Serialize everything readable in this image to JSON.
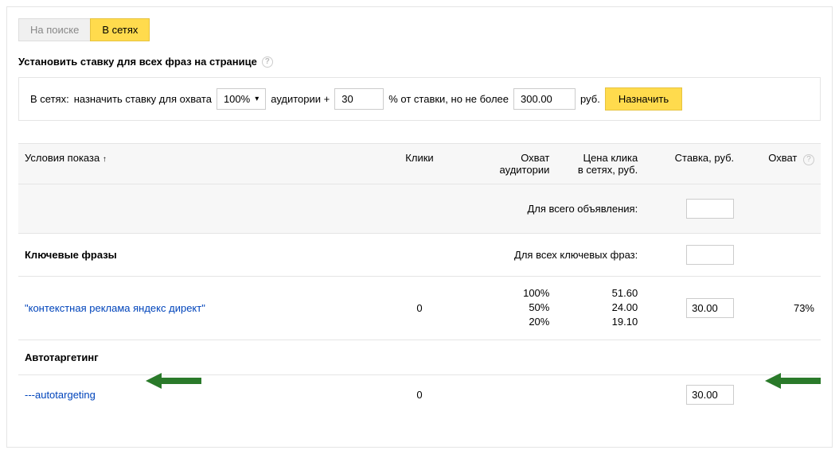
{
  "tabs": {
    "search": "На поиске",
    "networks": "В сетях"
  },
  "heading": "Установить ставку для всех фраз на странице",
  "rule": {
    "prefix": "В сетях:",
    "mid1": "назначить ставку для охвата",
    "pct": "100%",
    "mid2": "аудитории +",
    "plus": "30",
    "mid3": "% от ставки, но не более",
    "cap": "300.00",
    "cur": "руб.",
    "btn": "Назначить"
  },
  "headers": {
    "cond": "Условия показа",
    "sort": "↑",
    "clicks": "Клики",
    "reach_l1": "Охват",
    "reach_l2": "аудитории",
    "cpc_l1": "Цена клика",
    "cpc_l2": "в сетях, руб.",
    "rate": "Ставка, руб.",
    "cov": "Охват"
  },
  "all_ad": "Для всего объявления:",
  "sections": {
    "keywords": "Ключевые фразы",
    "all_kw": "Для всех ключевых фраз:",
    "auto": "Автотаргетинг"
  },
  "rows": {
    "kw": {
      "text": "\"контекстная реклама яндекс директ\"",
      "clicks": "0",
      "tiers_reach": "100%\n50%\n20%",
      "tiers_cpc": "51.60\n24.00\n19.10",
      "rate": "30.00",
      "cov": "73%"
    },
    "auto": {
      "text": "---autotargeting",
      "clicks": "0",
      "rate": "30.00"
    }
  }
}
